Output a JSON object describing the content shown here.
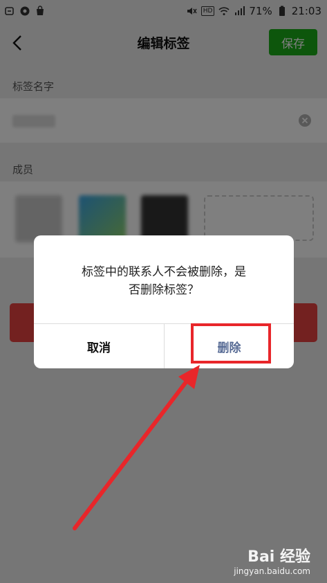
{
  "status_bar": {
    "battery": "71%",
    "time": "21:03",
    "hd": "HD"
  },
  "header": {
    "title": "编辑标签",
    "save_label": "保存"
  },
  "form": {
    "name_label": "标签名字",
    "members_label": "成员"
  },
  "dialog": {
    "message_line1": "标签中的联系人不会被删除，是",
    "message_line2": "否删除标签？",
    "cancel_label": "取消",
    "delete_label": "删除"
  },
  "watermark": {
    "brand": "Bai 经验",
    "url": "jingyan.baidu.com"
  },
  "colors": {
    "accent_green": "#1aad19",
    "danger_red": "#e64340",
    "dialog_link": "#576b95",
    "annotation_red": "#e8262a"
  }
}
